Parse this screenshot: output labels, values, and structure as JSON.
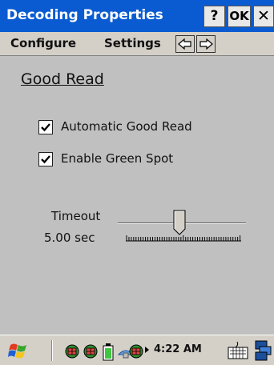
{
  "window": {
    "title": "Decoding Properties",
    "help_label": "?",
    "ok_label": "OK",
    "close_label": "✕"
  },
  "menu": {
    "configure": "Configure",
    "settings": "Settings",
    "prev_icon": "left-arrow-icon",
    "next_icon": "right-arrow-icon"
  },
  "section": {
    "title": "Good Read"
  },
  "options": [
    {
      "label": "Automatic Good Read",
      "checked": true
    },
    {
      "label": "Enable Green Spot",
      "checked": true
    }
  ],
  "timeout": {
    "label": "Timeout",
    "value": "5.00 sec",
    "slider_fraction": 0.48
  },
  "taskbar": {
    "clock": "4:22 AM",
    "icons": [
      "start-flag-icon",
      "network-icon",
      "network-icon",
      "battery-icon",
      "bluetooth-icon",
      "network-icon",
      "keyboard-icon",
      "sip-toggle-icon"
    ]
  },
  "colors": {
    "titlebar": "#0a5bd1",
    "background": "#c0c0c0"
  }
}
